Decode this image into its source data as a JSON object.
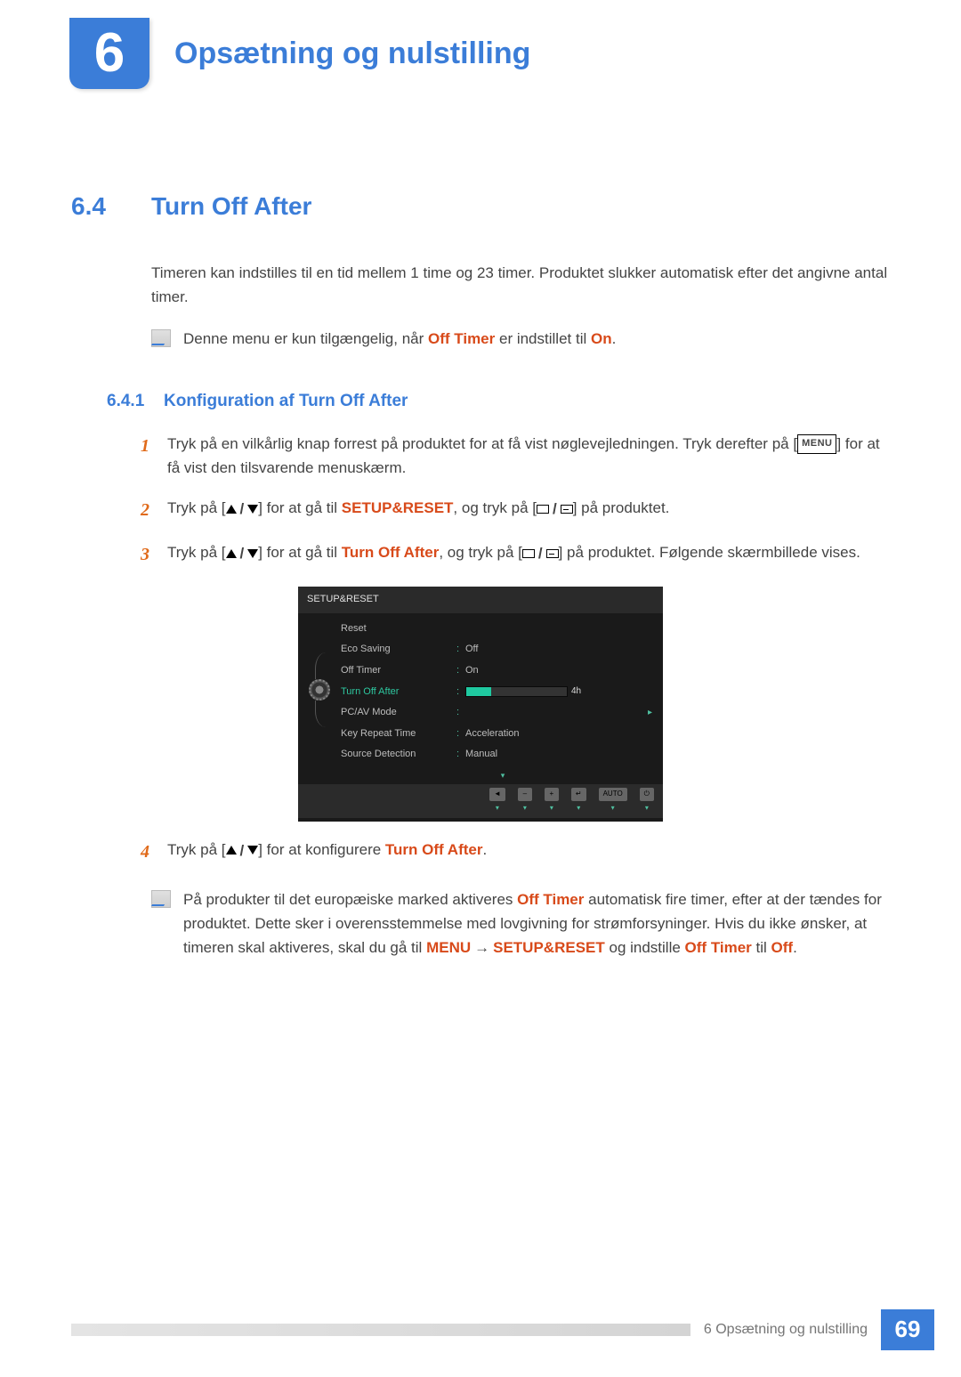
{
  "chapter": {
    "number": "6",
    "title": "Opsætning og nulstilling"
  },
  "section": {
    "number": "6.4",
    "title": "Turn Off After"
  },
  "intro": "Timeren kan indstilles til en tid mellem 1 time og 23 timer. Produktet slukker automatisk efter det angivne antal timer.",
  "note1": {
    "pre": "Denne menu er kun tilgængelig, når ",
    "hl1": "Off Timer",
    "mid": " er indstillet til ",
    "hl2": "On",
    "post": "."
  },
  "subsection": {
    "number": "6.4.1",
    "title": "Konfiguration af Turn Off After"
  },
  "steps": {
    "s1": {
      "num": "1",
      "a": "Tryk på en vilkårlig knap forrest på produktet for at få vist nøglevejledningen. Tryk derefter på [",
      "menu": "MENU",
      "b": "] for at få vist den tilsvarende menuskærm."
    },
    "s2": {
      "num": "2",
      "a": "Tryk på [",
      "b": "] for at gå til ",
      "hl": "SETUP&RESET",
      "c": ", og tryk på [",
      "d": "] på produktet."
    },
    "s3": {
      "num": "3",
      "a": "Tryk på [",
      "b": "] for at gå til ",
      "hl": "Turn Off After",
      "c": ", og tryk på [",
      "d": "] på produktet. Følgende skærmbillede vises."
    },
    "s4": {
      "num": "4",
      "a": "Tryk på [",
      "b": "] for at konfigurere ",
      "hl": "Turn Off After",
      "c": "."
    }
  },
  "osd": {
    "title": "SETUP&RESET",
    "rows": [
      {
        "label": "Reset",
        "val": ""
      },
      {
        "label": "Eco Saving",
        "val": "Off"
      },
      {
        "label": "Off Timer",
        "val": "On"
      },
      {
        "label": "Turn Off After",
        "val": "4h",
        "selected": true,
        "bar": true
      },
      {
        "label": "PC/AV Mode",
        "val": "",
        "caret": true
      },
      {
        "label": "Key Repeat Time",
        "val": "Acceleration"
      },
      {
        "label": "Source Detection",
        "val": "Manual"
      }
    ],
    "footer": [
      "◄",
      "–",
      "+",
      "↵",
      "AUTO",
      "⏻"
    ]
  },
  "note2": {
    "a": "På produkter til det europæiske marked aktiveres ",
    "hl1": "Off Timer",
    "b": " automatisk fire timer, efter at der tændes for produktet. Dette sker i overensstemmelse med lovgivning for strømforsyninger. Hvis du ikke ønsker, at timeren skal aktiveres, skal du gå til ",
    "hl2": "MENU",
    "arrow": "→",
    "hl3": "SETUP&RESET",
    "c": " og indstille ",
    "hl4": "Off Timer",
    "d": " til ",
    "hl5": "Off",
    "e": "."
  },
  "footer": {
    "text": "6 Opsætning og nulstilling",
    "page": "69"
  }
}
